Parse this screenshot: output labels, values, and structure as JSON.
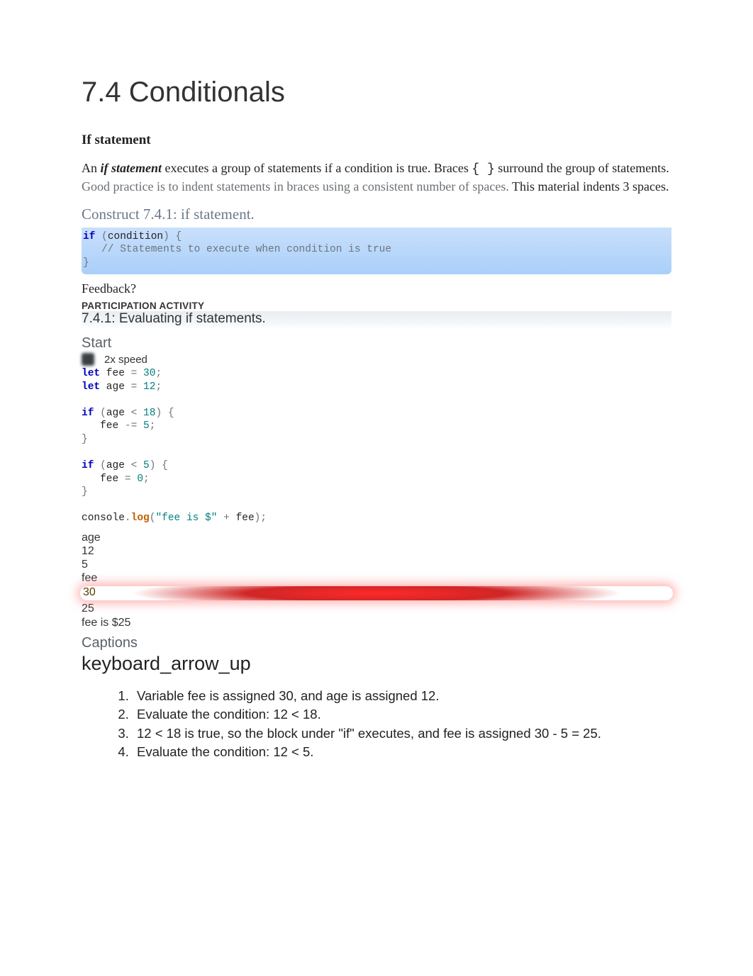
{
  "page": {
    "title": "7.4 Conditionals",
    "subheading": "If statement",
    "intro_pre": "An ",
    "intro_term": "if statement",
    "intro_post1": " executes a group of statements if a condition is true. Braces ",
    "intro_braces": "{ }",
    "intro_post2": " surround the group of statements. ",
    "good_practice": "Good practice is to indent statements in braces using a consistent number of spaces.",
    "intro_tail": " This material indents 3 spaces."
  },
  "construct": {
    "title": "Construct 7.4.1: if statement.",
    "kw1": "if",
    "lp": " (",
    "cond": "condition",
    "rp": ")",
    "ob": " {",
    "cmt": "   // Statements to execute when condition is true",
    "cb": "}"
  },
  "feedback": "Feedback?",
  "activity": {
    "label": "PARTICIPATION ACTIVITY",
    "title": "7.4.1: Evaluating if statements.",
    "start": "Start",
    "speed": "2x speed"
  },
  "code2": {
    "l1_kw": "let",
    "l1_rest": " fee ",
    "l1_eq": "=",
    "l1_num": " 30",
    "l1_sc": ";",
    "l2_kw": "let",
    "l2_rest": " age ",
    "l2_eq": "=",
    "l2_num": " 12",
    "l2_sc": ";",
    "l4_kw": "if",
    "l4_lp": " (",
    "l4_a": "age ",
    "l4_lt": "<",
    "l4_n": " 18",
    "l4_rp": ")",
    "l4_ob": " {",
    "l5": "   fee ",
    "l5_op": "-=",
    "l5_n": " 5",
    "l5_sc": ";",
    "l6_cb": "}",
    "l8_kw": "if",
    "l8_lp": " (",
    "l8_a": "age ",
    "l8_lt": "<",
    "l8_n": " 5",
    "l8_rp": ")",
    "l8_ob": " {",
    "l9": "   fee ",
    "l9_op": "=",
    "l9_n": " 0",
    "l9_sc": ";",
    "l10_cb": "}",
    "l12_a": "console",
    "l12_d": ".",
    "l12_fn": "log",
    "l12_lp": "(",
    "l12_s": "\"fee is $\"",
    "l12_p": " + ",
    "l12_v": "fee",
    "l12_rp": ")",
    "l12_sc": ";"
  },
  "mem": {
    "age_label": "age",
    "age_v1": "12",
    "age_v2": "5",
    "fee_label": "fee",
    "fee_v1": "30",
    "fee_v2": "25",
    "output": "fee is $25"
  },
  "captions": {
    "heading": "Captions",
    "arrow": "keyboard_arrow_up",
    "items": [
      "Variable fee is assigned 30, and age is assigned 12.",
      "Evaluate the condition: 12 < 18.",
      "12 < 18 is true, so the block under \"if\" executes, and fee is assigned 30 - 5 = 25.",
      "Evaluate the condition: 12 < 5."
    ]
  }
}
